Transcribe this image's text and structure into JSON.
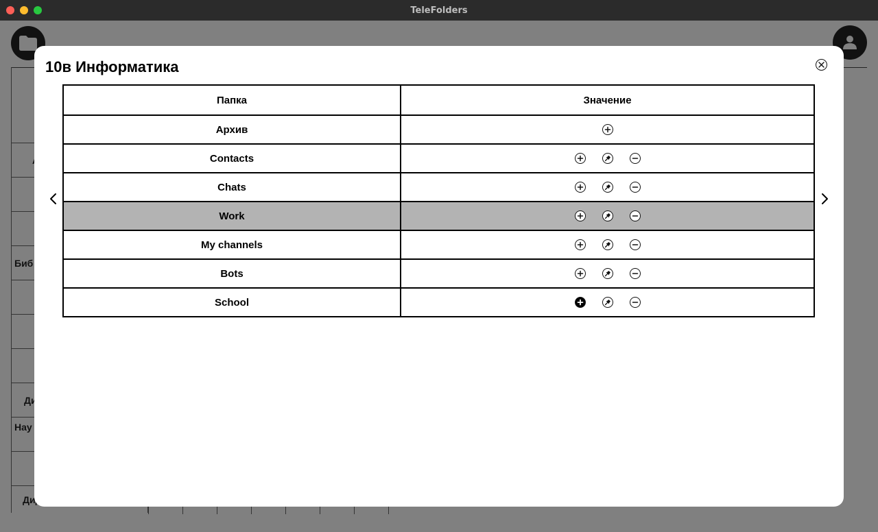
{
  "window": {
    "title": "TeleFolders"
  },
  "background": {
    "rows": [
      "А",
      "Биб",
      "Ди",
      "Нау",
      "Дидактические..."
    ]
  },
  "modal": {
    "title": "10в Информатика",
    "columns": [
      "Папка",
      "Значение"
    ],
    "rows": [
      {
        "folder": "Архив",
        "actions": [
          "add"
        ],
        "selected": false
      },
      {
        "folder": "Contacts",
        "actions": [
          "add",
          "pin",
          "remove"
        ],
        "selected": false
      },
      {
        "folder": "Chats",
        "actions": [
          "add",
          "pin",
          "remove"
        ],
        "selected": false
      },
      {
        "folder": "Work",
        "actions": [
          "add",
          "pin",
          "remove"
        ],
        "selected": true
      },
      {
        "folder": "My channels",
        "actions": [
          "add",
          "pin",
          "remove"
        ],
        "selected": false
      },
      {
        "folder": "Bots",
        "actions": [
          "add",
          "pin",
          "remove"
        ],
        "selected": false
      },
      {
        "folder": "School",
        "actions": [
          "add-filled",
          "pin",
          "remove"
        ],
        "selected": false
      }
    ]
  },
  "icons": {
    "add": "plus-circle-icon",
    "pin": "pin-icon",
    "remove": "minus-circle-icon",
    "close": "close-circle-icon",
    "prev": "chevron-left-icon",
    "next": "chevron-right-icon"
  },
  "colors": {
    "titlebar": "#2b2b2b",
    "overlay": "#808080",
    "selected_row": "#b3b3b3"
  }
}
